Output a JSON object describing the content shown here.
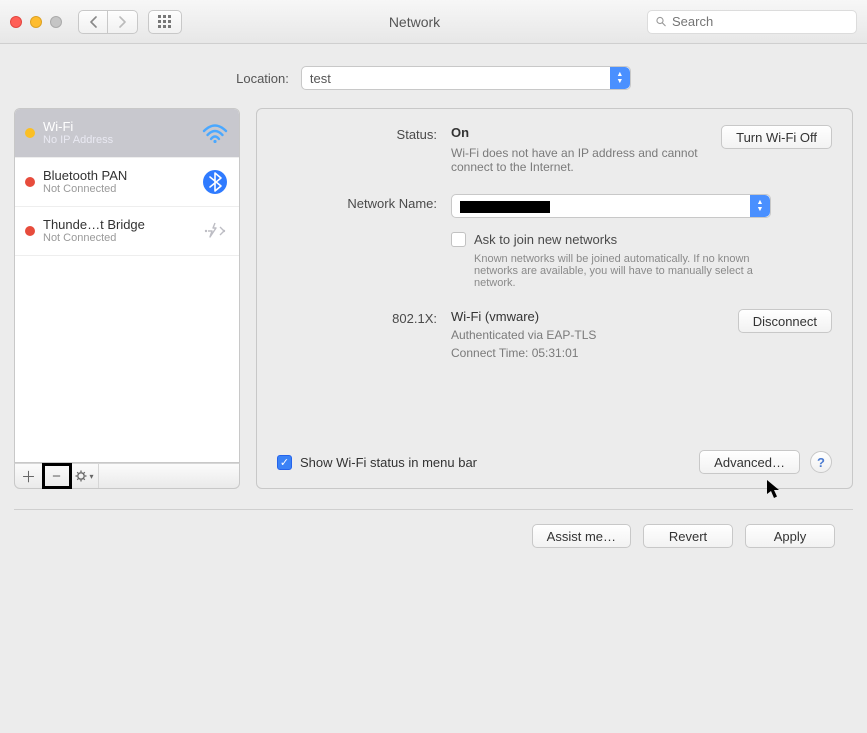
{
  "titlebar": {
    "title": "Network",
    "search_placeholder": "Search"
  },
  "location": {
    "label": "Location:",
    "value": "test"
  },
  "services": [
    {
      "name": "Wi-Fi",
      "status": "No IP Address",
      "dot": "yellow",
      "icon": "wifi",
      "selected": true
    },
    {
      "name": "Bluetooth PAN",
      "status": "Not Connected",
      "dot": "red",
      "icon": "bluetooth",
      "selected": false
    },
    {
      "name": "Thunde…t Bridge",
      "status": "Not Connected",
      "dot": "red",
      "icon": "thunderbolt",
      "selected": false
    }
  ],
  "detail": {
    "status_label": "Status:",
    "status_value": "On",
    "wifi_toggle_label": "Turn Wi-Fi Off",
    "status_desc": "Wi-Fi does not have an IP address and cannot connect to the Internet.",
    "netname_label": "Network Name:",
    "netname_value": "████████",
    "ask_join_label": "Ask to join new networks",
    "ask_join_hint": "Known networks will be joined automatically. If no known networks are available, you will have to manually select a network.",
    "x_label": "802.1X:",
    "x_profile": "Wi-Fi (vmware)",
    "x_disconnect": "Disconnect",
    "x_auth": "Authenticated via EAP-TLS",
    "x_time": "Connect Time: 05:31:01",
    "show_status_label": "Show Wi-Fi status in menu bar",
    "advanced_label": "Advanced…"
  },
  "footer": {
    "assist": "Assist me…",
    "revert": "Revert",
    "apply": "Apply"
  }
}
